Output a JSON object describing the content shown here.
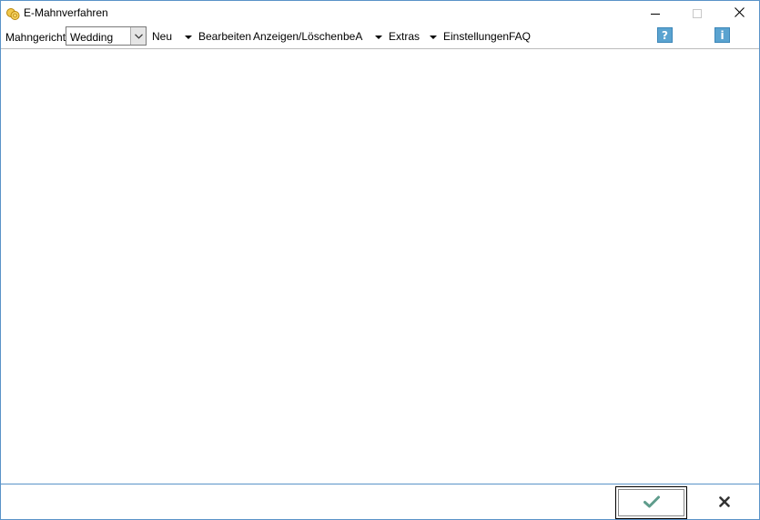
{
  "window": {
    "title": "E-Mahnverfahren",
    "app_icon": "coins-icon"
  },
  "toolbar": {
    "court_label": "Mahngericht:",
    "court_select": {
      "value": "Wedding"
    },
    "menu": {
      "neu": "Neu",
      "bearbeiten": "Bearbeiten",
      "anzeigen_loeschen": "Anzeigen/Löschen",
      "bea": "beA",
      "extras": "Extras",
      "einstellungen": "Einstellungen",
      "faq": "FAQ"
    },
    "help_glyph": "?",
    "info_glyph": "i"
  },
  "colors": {
    "window_border": "#5a93c8",
    "help_blue": "#5aa3d0",
    "ok_check": "#5f9c8c",
    "cancel_x": "#333333"
  },
  "footer": {
    "ok_icon": "checkmark-icon",
    "cancel_icon": "x-icon"
  }
}
